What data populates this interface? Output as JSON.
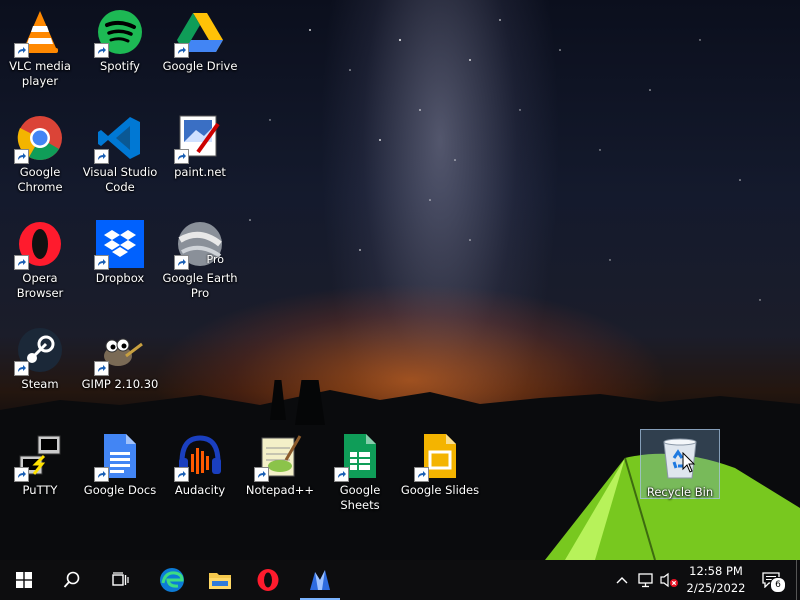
{
  "desktop": {
    "icons": [
      {
        "label": "VLC media player",
        "icon": "vlc-icon"
      },
      {
        "label": "Spotify",
        "icon": "spotify-icon"
      },
      {
        "label": "Google Drive",
        "icon": "google-drive-icon"
      },
      {
        "label": "Google Chrome",
        "icon": "chrome-icon"
      },
      {
        "label": "Visual Studio Code",
        "icon": "vscode-icon"
      },
      {
        "label": "paint.net",
        "icon": "paintnet-icon"
      },
      {
        "label": "Opera Browser",
        "icon": "opera-icon"
      },
      {
        "label": "Dropbox",
        "icon": "dropbox-icon"
      },
      {
        "label": "Google Earth Pro",
        "icon": "google-earth-icon",
        "badge": "Pro"
      },
      {
        "label": "Steam",
        "icon": "steam-icon"
      },
      {
        "label": "GIMP 2.10.30",
        "icon": "gimp-icon"
      },
      {
        "label": "PuTTY",
        "icon": "putty-icon"
      },
      {
        "label": "Google Docs",
        "icon": "google-docs-icon"
      },
      {
        "label": "Audacity",
        "icon": "audacity-icon"
      },
      {
        "label": "Notepad++",
        "icon": "notepadpp-icon"
      },
      {
        "label": "Google Sheets",
        "icon": "google-sheets-icon"
      },
      {
        "label": "Google Slides",
        "icon": "google-slides-icon"
      },
      {
        "label": "Recycle Bin",
        "icon": "recycle-bin-icon",
        "selected": true
      }
    ]
  },
  "taskbar": {
    "pinned": [
      "start-icon",
      "search-icon",
      "task-view-icon",
      "edge-icon",
      "file-explorer-icon",
      "opera-icon",
      "app-icon"
    ],
    "tray": {
      "time": "12:58 PM",
      "date": "2/25/2022",
      "notification_count": "6"
    }
  },
  "colors": {
    "taskbar": "#0d0d0f",
    "accent": "#7ab3ff",
    "selection": "#78a0c8"
  }
}
